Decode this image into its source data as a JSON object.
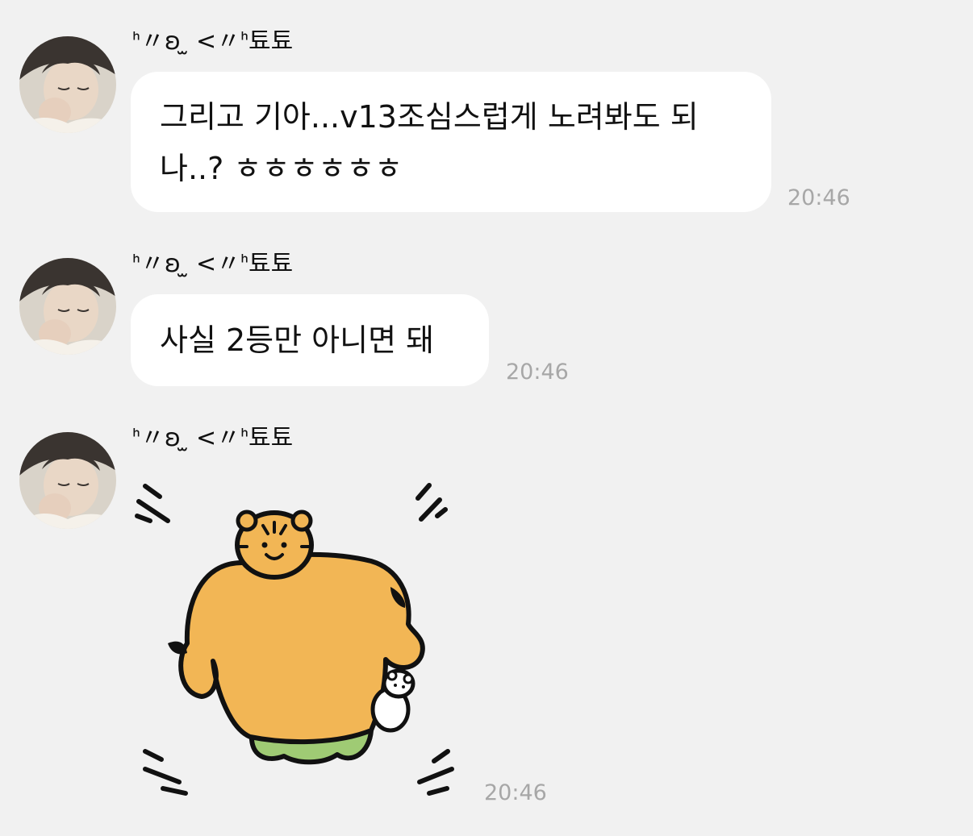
{
  "messages": [
    {
      "sender": "ᑋ〃ʚ ̫ <〃ᑋ툐툐",
      "text": "그리고 기아...v13조심스럽게 노려봐도 되나..? ㅎㅎㅎㅎㅎㅎ",
      "time": "20:46"
    },
    {
      "sender": "ᑋ〃ʚ ̫ <〃ᑋ툐툐",
      "text": "사실 2등만 아니면 돼",
      "time": "20:46"
    },
    {
      "sender": "ᑋ〃ʚ ̫ <〃ᑋ툐툐",
      "sticker": "tiger-sticker",
      "time": "20:46"
    }
  ],
  "colors": {
    "background": "#f1f1f1",
    "bubble": "#ffffff",
    "timestamp": "#a7a7a7",
    "tiger": "#f2b655",
    "pants": "#9fcb74"
  }
}
